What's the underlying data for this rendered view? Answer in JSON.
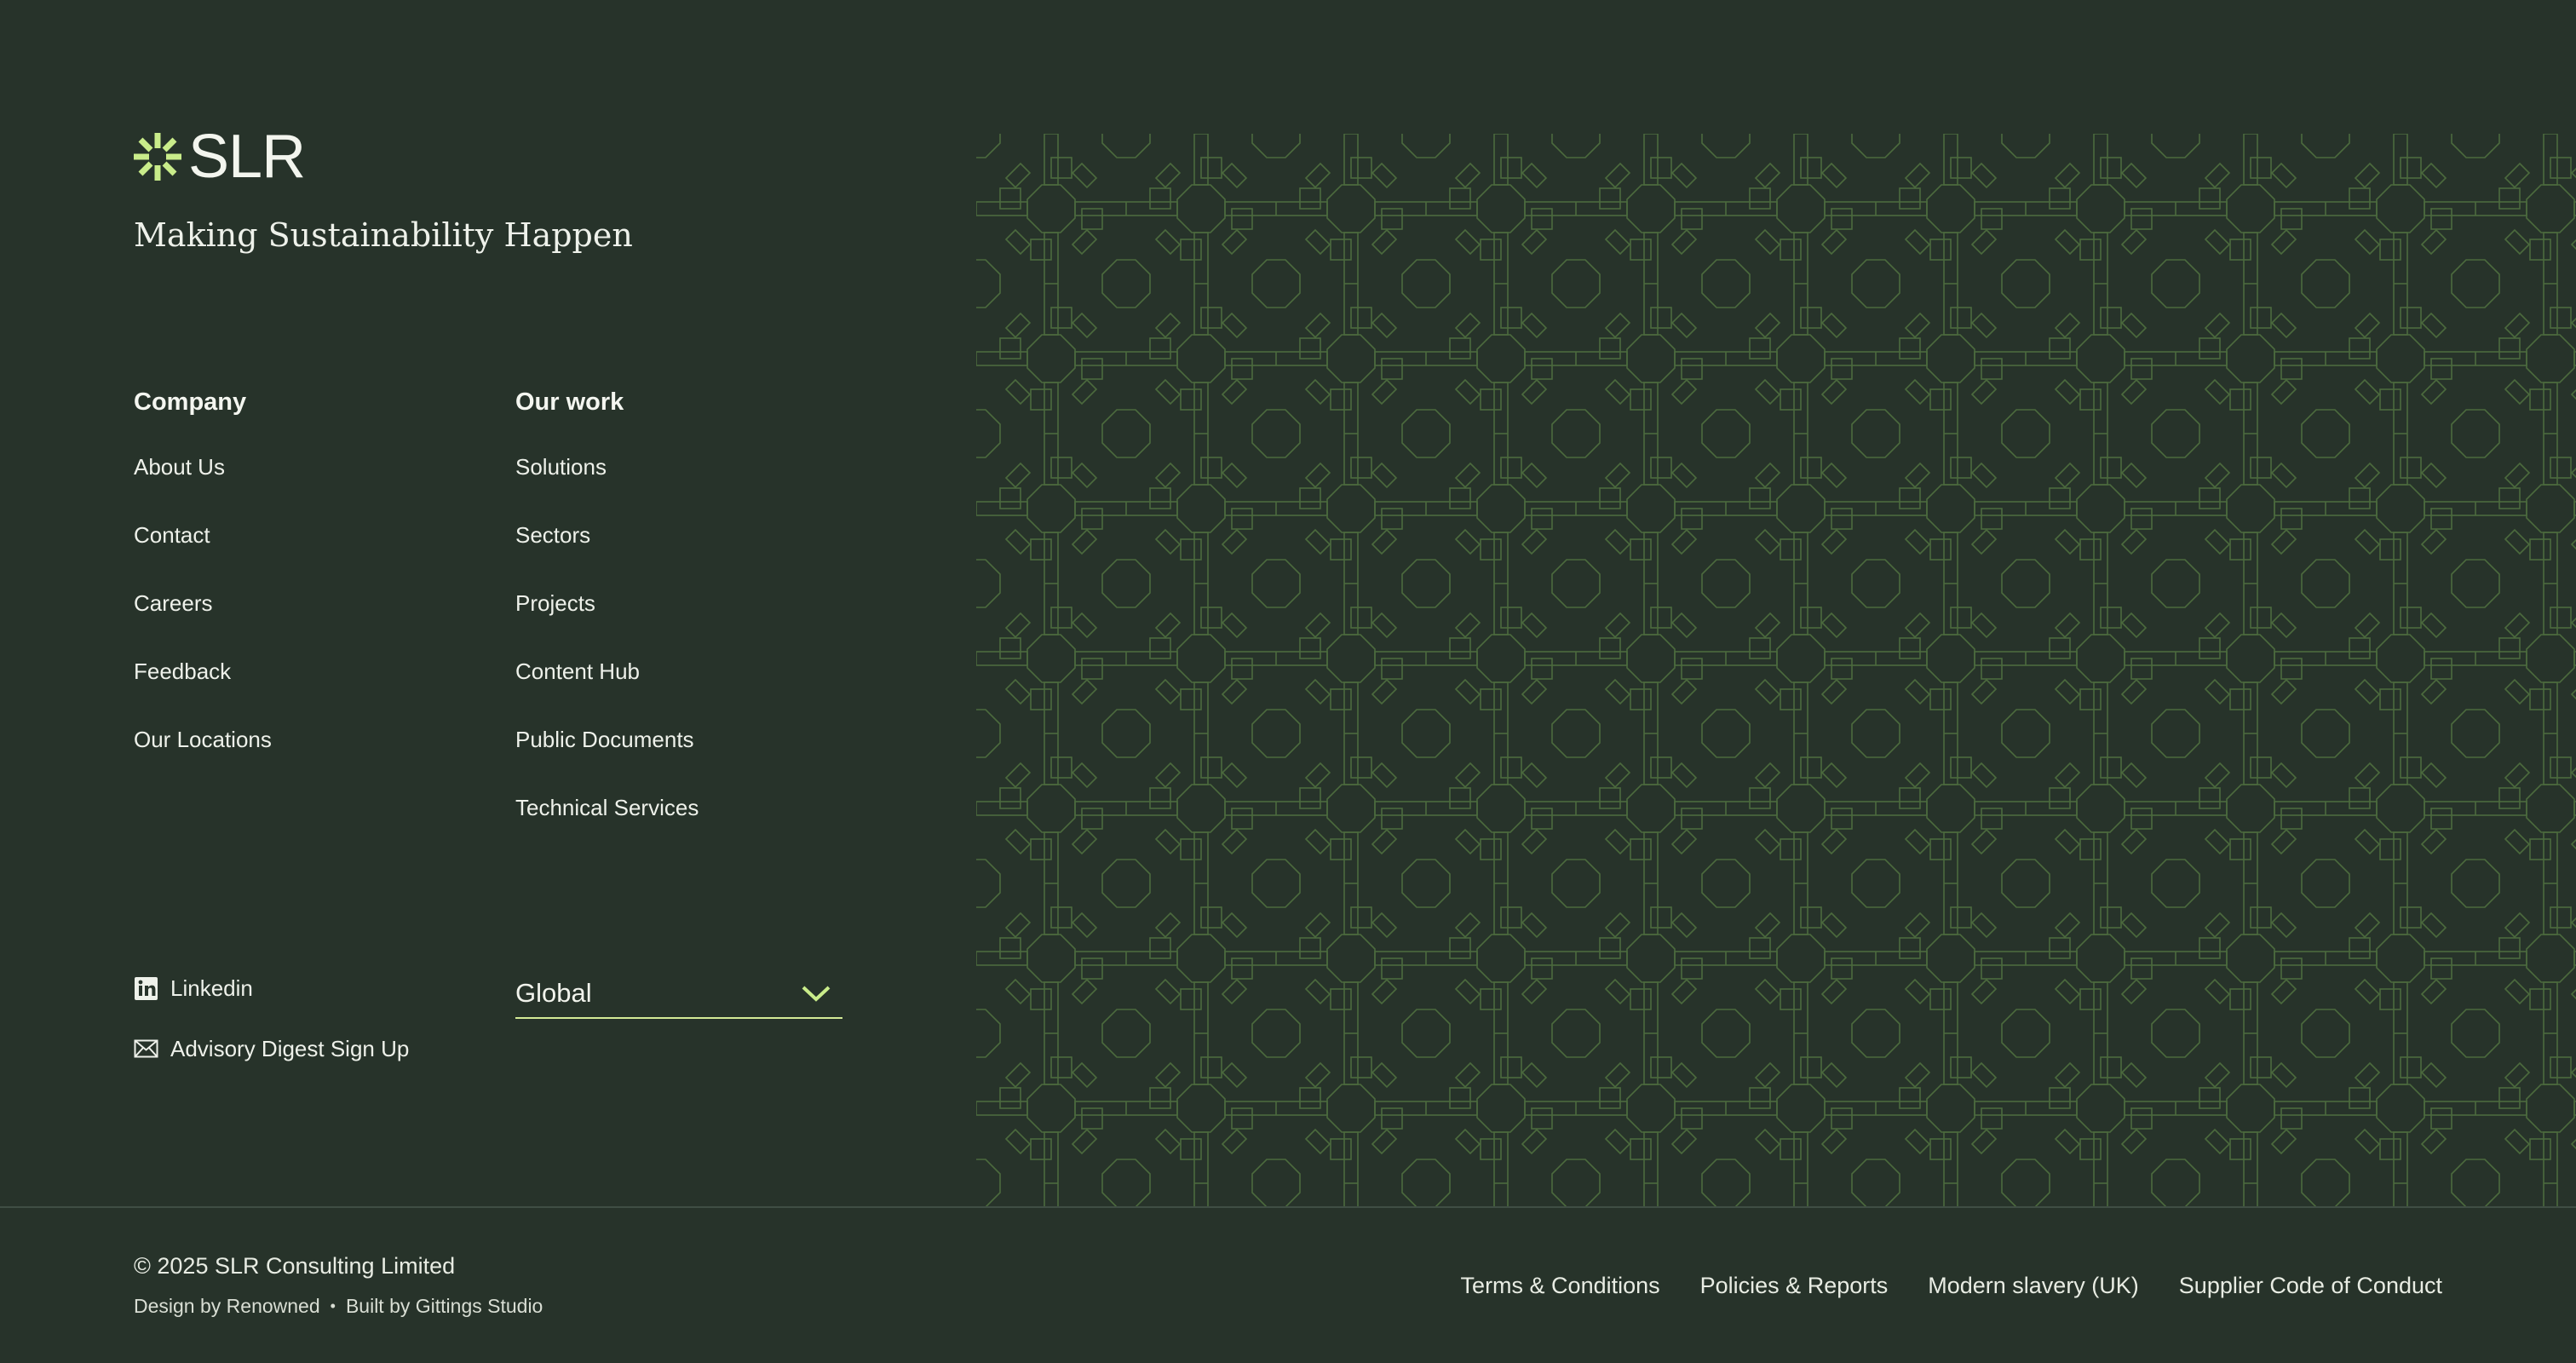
{
  "brand": {
    "name": "SLR",
    "tagline": "Making Sustainability Happen",
    "accent_color": "#c9ec8a",
    "background_color": "#27332a",
    "pattern_color": "#4b6a3d"
  },
  "nav": {
    "company": {
      "heading": "Company",
      "links": [
        "About Us",
        "Contact",
        "Careers",
        "Feedback",
        "Our Locations"
      ]
    },
    "work": {
      "heading": "Our work",
      "links": [
        "Solutions",
        "Sectors",
        "Projects",
        "Content Hub",
        "Public Documents",
        "Technical Services"
      ]
    }
  },
  "social": {
    "linkedin": {
      "label": "Linkedin",
      "icon": "linkedin-icon"
    },
    "digest": {
      "label": "Advisory Digest Sign Up",
      "icon": "mail-icon"
    }
  },
  "region_select": {
    "value": "Global",
    "icon": "chevron-down-icon"
  },
  "bottom": {
    "copyright": "© 2025 SLR Consulting Limited",
    "design_credit": "Design by Renowned",
    "separator": "•",
    "build_credit": "Built by Gittings Studio",
    "legal_links": [
      "Terms & Conditions",
      "Policies & Reports",
      "Modern slavery (UK)",
      "Supplier Code of Conduct"
    ]
  }
}
